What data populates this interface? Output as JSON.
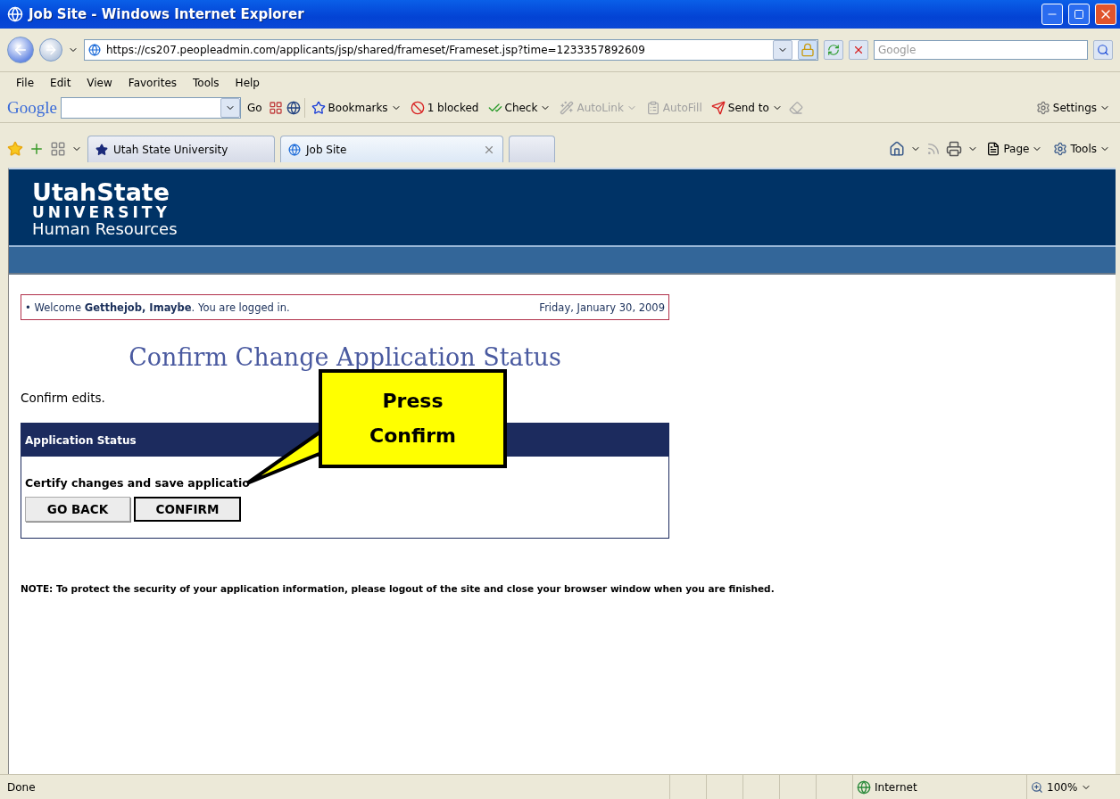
{
  "window": {
    "title": "Job Site - Windows Internet Explorer"
  },
  "address_bar": {
    "url": "https://cs207.peopleadmin.com/applicants/jsp/shared/frameset/Frameset.jsp?time=1233357892609"
  },
  "search": {
    "placeholder": "Google"
  },
  "menu": [
    "File",
    "Edit",
    "View",
    "Favorites",
    "Tools",
    "Help"
  ],
  "google_toolbar": {
    "logo": "Google",
    "go": "Go",
    "items": [
      {
        "label": "Bookmarks",
        "disabled": false,
        "dropdown": true
      },
      {
        "label": "1 blocked",
        "disabled": false,
        "dropdown": false
      },
      {
        "label": "Check",
        "disabled": false,
        "dropdown": true
      },
      {
        "label": "AutoLink",
        "disabled": true,
        "dropdown": true
      },
      {
        "label": "AutoFill",
        "disabled": true,
        "dropdown": false
      },
      {
        "label": "Send to",
        "disabled": false,
        "dropdown": true
      }
    ],
    "settings": "Settings"
  },
  "tabs": [
    {
      "label": "Utah State University",
      "selected": false
    },
    {
      "label": "Job Site",
      "selected": true
    }
  ],
  "command_bar": [
    "Page",
    "Tools"
  ],
  "header": {
    "wordmark": "UtahState",
    "subtitle": "UNIVERSITY",
    "department": "Human Resources"
  },
  "welcome": {
    "text": "• Welcome **Getthejob, Imaybe**. You are logged in.",
    "date": "Friday, January 30, 2009"
  },
  "page_title": "Confirm Change Application Status",
  "intro": "Confirm edits.",
  "panel": {
    "title": "Application Status",
    "prompt": "Certify changes and save applicatio",
    "buttons": [
      {
        "label": "GO BACK",
        "focused": false
      },
      {
        "label": "CONFIRM",
        "focused": true
      }
    ]
  },
  "note": "NOTE:   To protect the security of your application information, please logout of the site and close your browser window when you are finished.",
  "callout": {
    "lines": [
      "Press",
      "Confirm"
    ]
  },
  "status_bar": {
    "text": "Done",
    "zone": "Internet",
    "zoom": "100%"
  }
}
